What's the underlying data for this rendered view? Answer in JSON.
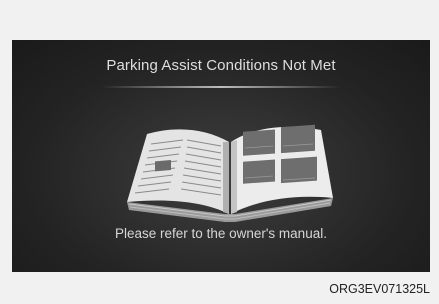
{
  "display": {
    "title": "Parking Assist Conditions Not Met",
    "message": "Please refer to the owner's manual."
  },
  "figure_code": "ORG3EV071325L",
  "icons": {
    "book": "open-manual-icon"
  },
  "colors": {
    "screen_background": "#2a2a2a",
    "text": "#dedede",
    "outer_background": "#f1f1f1"
  }
}
